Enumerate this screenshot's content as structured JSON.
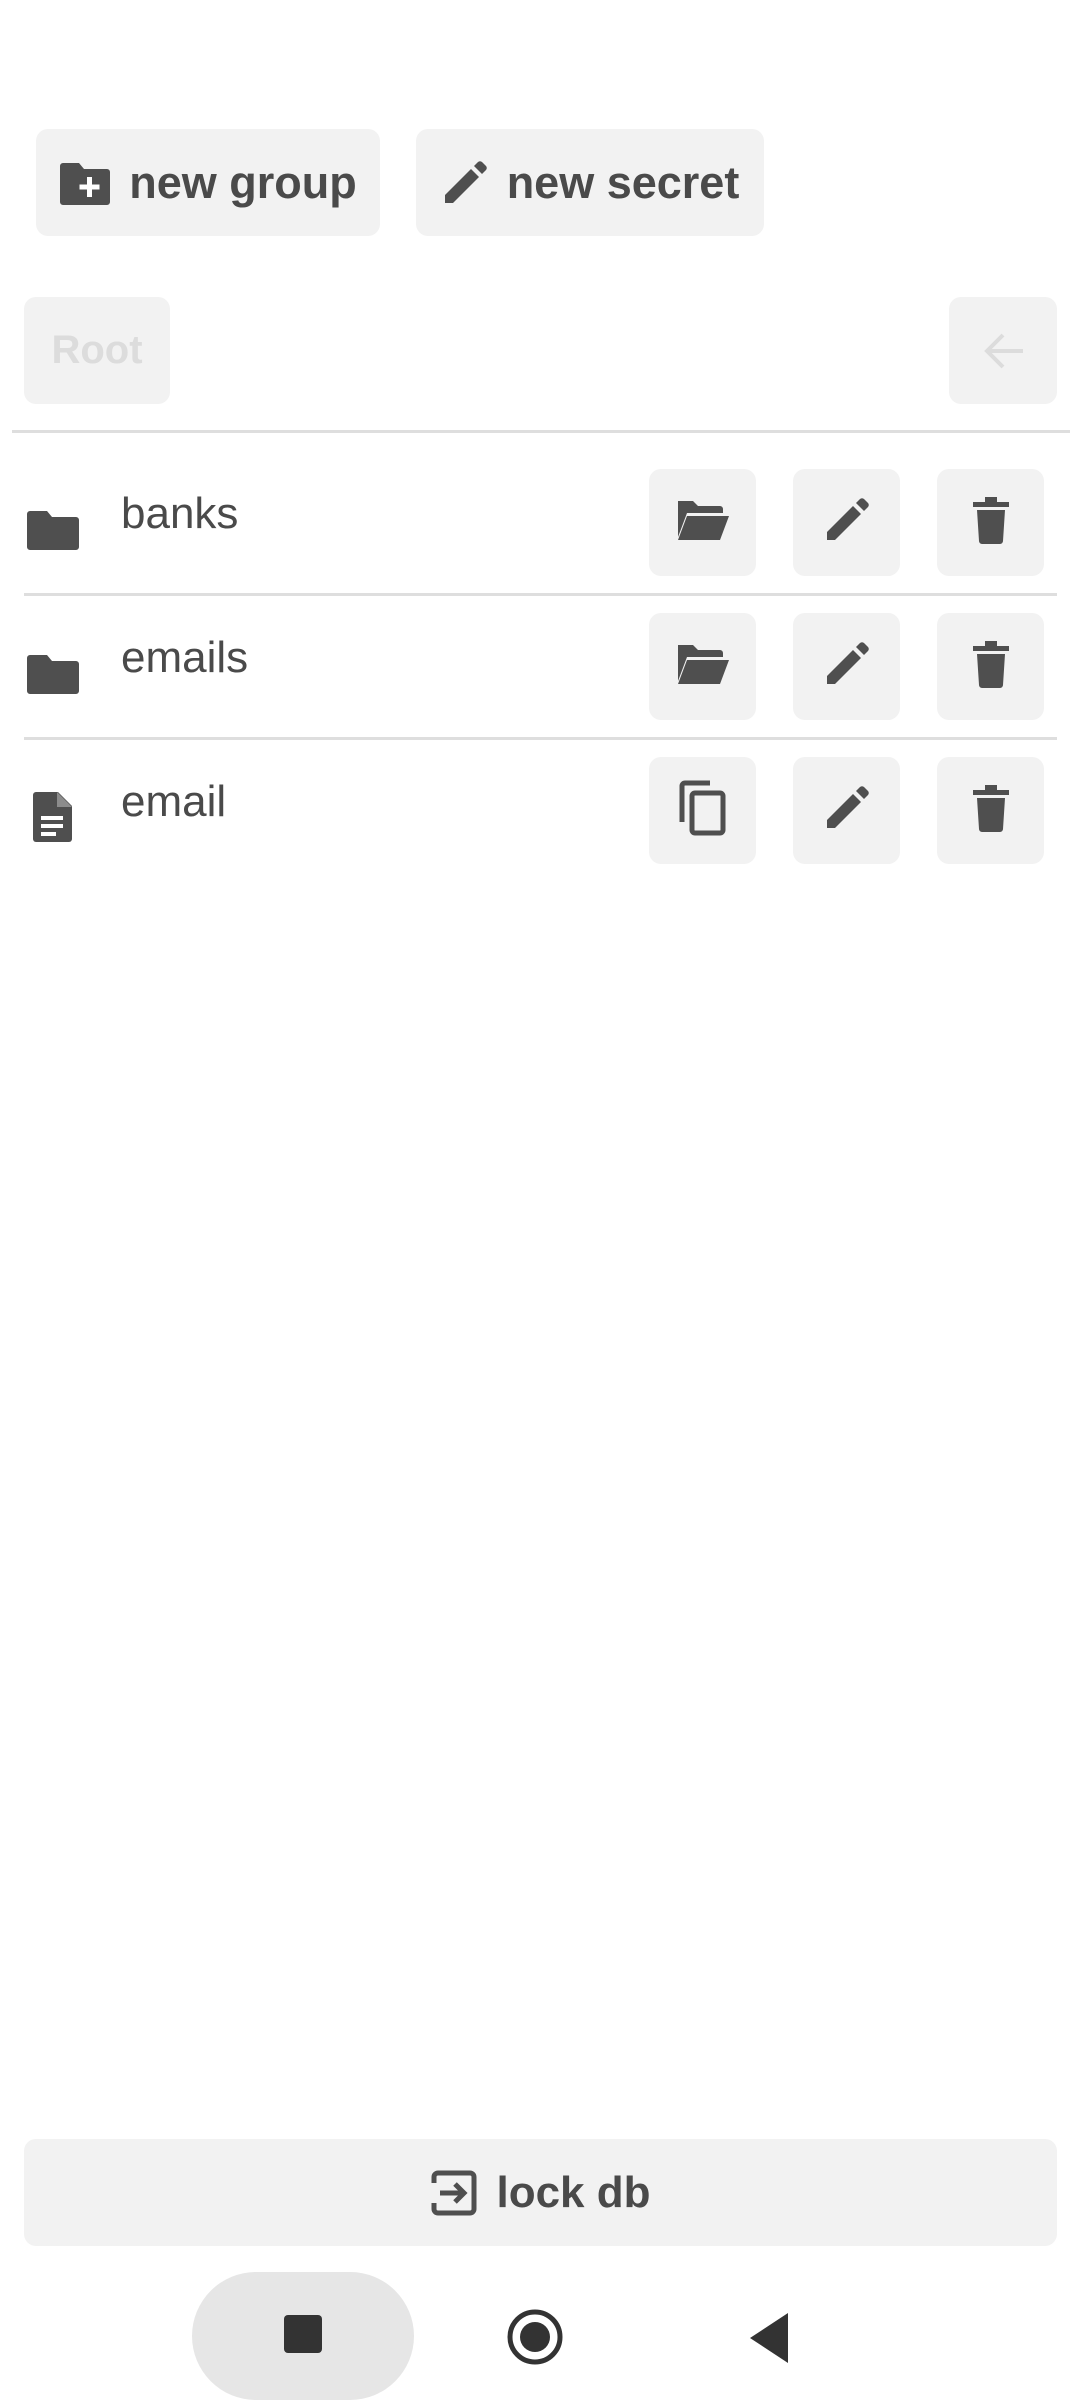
{
  "toolbar": {
    "new_group_label": "new group",
    "new_secret_label": "new secret"
  },
  "breadcrumb": {
    "root_label": "Root"
  },
  "entries": [
    {
      "name": "banks",
      "type": "group",
      "icons": [
        "folder-icon",
        "folder-open-icon",
        "pencil-icon",
        "trash-icon"
      ]
    },
    {
      "name": "emails",
      "type": "group",
      "icons": [
        "folder-icon",
        "folder-open-icon",
        "pencil-icon",
        "trash-icon"
      ]
    },
    {
      "name": "email",
      "type": "secret",
      "icons": [
        "document-icon",
        "copy-icon",
        "pencil-icon",
        "trash-icon"
      ]
    }
  ],
  "footer": {
    "lock_label": "lock db"
  },
  "colors": {
    "button_bg": "#f2f2f2",
    "icon": "#4f4f4f",
    "disabled": "#dcdcdc",
    "divider": "#dedede"
  }
}
